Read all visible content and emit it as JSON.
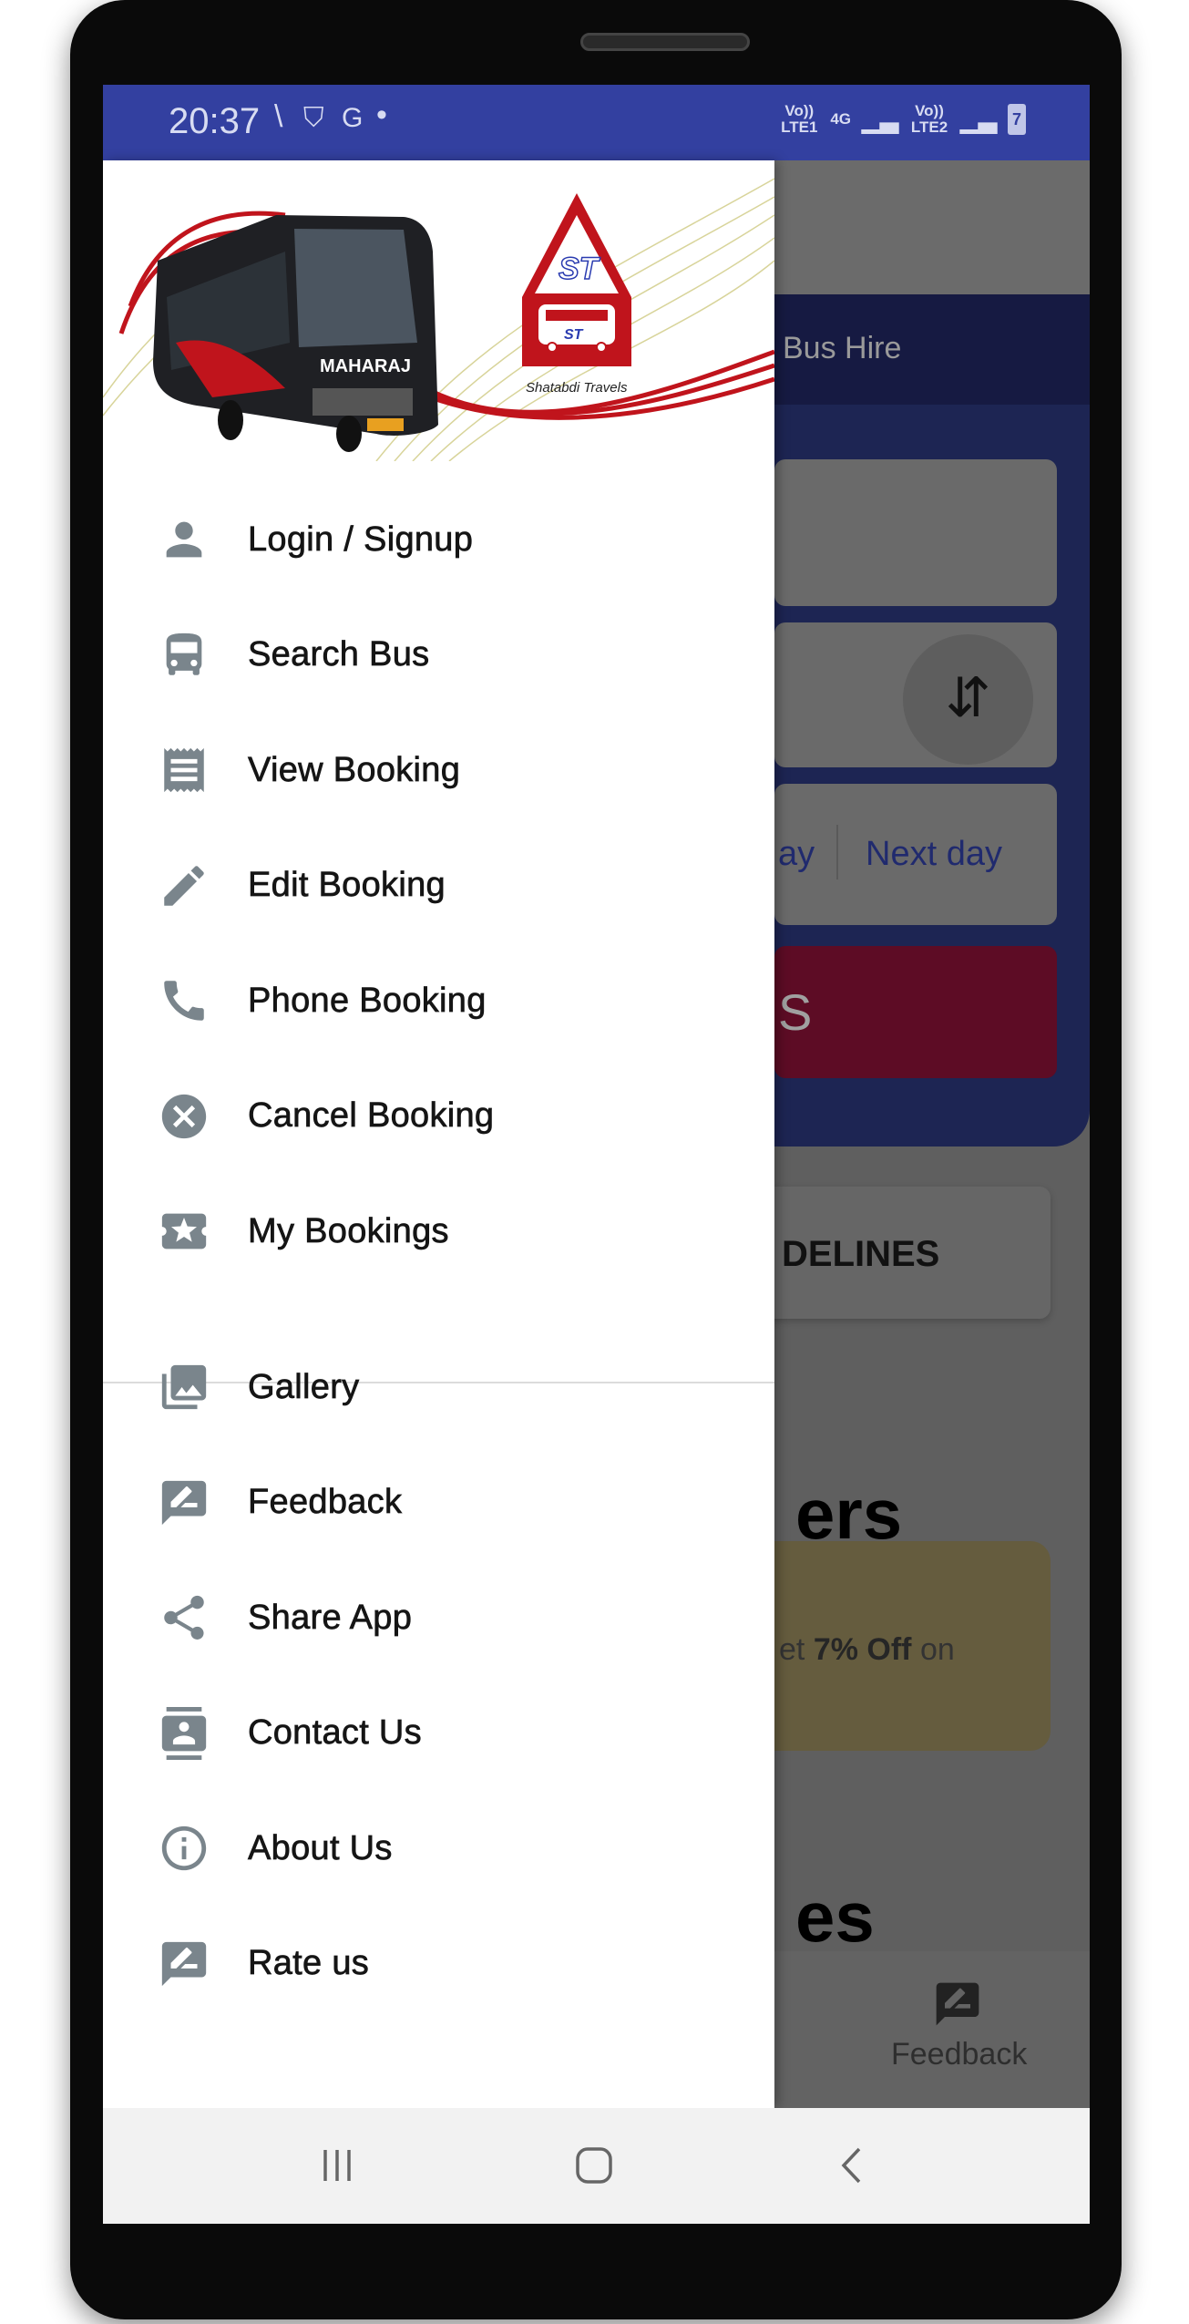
{
  "status_bar": {
    "time": "20:37",
    "sim1": "Vo)) LTE1",
    "network": "4G",
    "sim2": "Vo)) LTE2",
    "battery": "7"
  },
  "brand": {
    "name": "Shatabdi Travels",
    "logo_text": "ST",
    "bus_text": "MAHARAJ"
  },
  "drawer": {
    "primary_items": [
      {
        "label": "Login / Signup",
        "icon": "person-icon"
      },
      {
        "label": "Search Bus",
        "icon": "bus-icon"
      },
      {
        "label": "View Booking",
        "icon": "receipt-icon"
      },
      {
        "label": "Edit Booking",
        "icon": "pencil-icon"
      },
      {
        "label": "Phone Booking",
        "icon": "phone-icon"
      },
      {
        "label": "Cancel Booking",
        "icon": "cancel-icon"
      },
      {
        "label": "My Bookings",
        "icon": "ticket-star-icon"
      }
    ],
    "secondary_items": [
      {
        "label": "Gallery",
        "icon": "gallery-icon"
      },
      {
        "label": "Feedback",
        "icon": "feedback-icon"
      },
      {
        "label": "Share App",
        "icon": "share-icon"
      },
      {
        "label": "Contact Us",
        "icon": "contacts-icon"
      },
      {
        "label": "About Us",
        "icon": "info-icon"
      },
      {
        "label": "Rate us",
        "icon": "rate-review-icon"
      }
    ]
  },
  "background": {
    "tab_label": "Bus Hire",
    "date_today_partial": "ay",
    "date_next": "Next day",
    "search_button_partial": "S",
    "guidelines_partial": "DELINES",
    "offers_heading_partial": "ers",
    "offer_text_prefix": "et ",
    "offer_text_bold": "7% Off",
    "offer_text_suffix": " on",
    "section_heading_partial": "es",
    "bottom_nav_feedback": "Feedback"
  },
  "colors": {
    "status_bar": "#3340a0",
    "icon_gray": "#7a858c",
    "brand_red": "#c0141c",
    "brand_blue": "#2a3bb0"
  }
}
